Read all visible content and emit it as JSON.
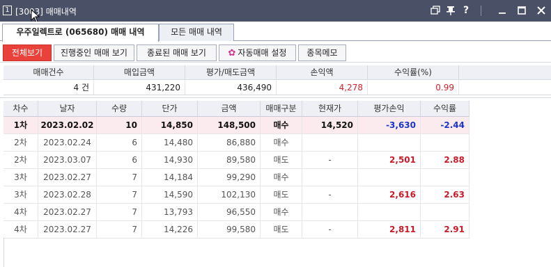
{
  "window": {
    "number": "1",
    "title": "[3003] 매매내역",
    "buttons": [
      "restore-icon",
      "pin-icon",
      "help-icon",
      "minimize-icon",
      "maximize-icon",
      "close-icon"
    ]
  },
  "top_tabs": [
    {
      "label": "우주일렉트로 (065680) 매매 내역",
      "active": true
    },
    {
      "label": "모든 매매 내역",
      "active": false
    }
  ],
  "sub_tabs": [
    {
      "label": "전체보기",
      "active": true
    },
    {
      "label": "진행중인 매매 보기",
      "active": false
    },
    {
      "label": "종료된 매매 보기",
      "active": false
    },
    {
      "label": "자동매매 설정",
      "active": false,
      "icon": "gear-icon"
    },
    {
      "label": "종목메모",
      "active": false
    }
  ],
  "summary": {
    "headers": [
      "매매건수",
      "매입금액",
      "평가/매도금액",
      "손익액",
      "수익률(%)"
    ],
    "values": [
      "4 건",
      "431,220",
      "436,490",
      "4,278",
      "0.99"
    ]
  },
  "table": {
    "headers": [
      "차수",
      "날자",
      "수량",
      "단가",
      "금액",
      "매매구분",
      "현재가",
      "평가손익",
      "수익률"
    ],
    "rows": [
      {
        "seq": "1차",
        "date": "2023.02.02",
        "qty": "10",
        "price": "14,850",
        "amount": "148,500",
        "type": "매수",
        "current": "14,520",
        "pnl": "-3,630",
        "rate": "-2.44",
        "highlight": true
      },
      {
        "seq": "2차",
        "date": "2023.02.24",
        "qty": "6",
        "price": "14,480",
        "amount": "86,880",
        "type": "매수",
        "current": "",
        "pnl": "",
        "rate": ""
      },
      {
        "seq": "2차",
        "date": "2023.03.07",
        "qty": "6",
        "price": "14,930",
        "amount": "89,580",
        "type": "매도",
        "current": "-",
        "pnl": "2,501",
        "rate": "2.88"
      },
      {
        "seq": "3차",
        "date": "2023.02.27",
        "qty": "7",
        "price": "14,184",
        "amount": "99,290",
        "type": "매수",
        "current": "",
        "pnl": "",
        "rate": ""
      },
      {
        "seq": "3차",
        "date": "2023.02.28",
        "qty": "7",
        "price": "14,590",
        "amount": "102,130",
        "type": "매도",
        "current": "-",
        "pnl": "2,616",
        "rate": "2.63"
      },
      {
        "seq": "4차",
        "date": "2023.02.27",
        "qty": "7",
        "price": "13,793",
        "amount": "96,550",
        "type": "매수",
        "current": "",
        "pnl": "",
        "rate": ""
      },
      {
        "seq": "4차",
        "date": "2023.02.27",
        "qty": "7",
        "price": "14,226",
        "amount": "99,580",
        "type": "매도",
        "current": "-",
        "pnl": "2,811",
        "rate": "2.91"
      }
    ]
  },
  "colors": {
    "titlebar": "#4a5066",
    "active_tab": "#e8423a",
    "profit": "#d0222d",
    "loss": "#1a36c8",
    "highlight_row": "#fcebee"
  }
}
